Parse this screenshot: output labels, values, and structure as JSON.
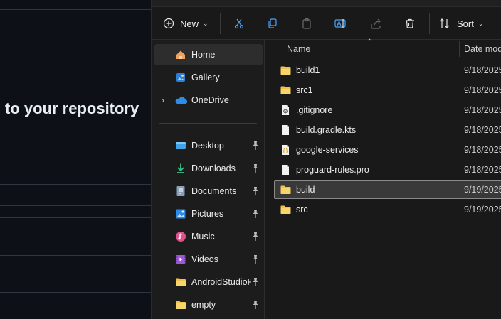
{
  "background_window": {
    "heading": "to your repository"
  },
  "toolbar": {
    "new_label": "New",
    "sort_label": "Sort"
  },
  "nav": {
    "items": [
      {
        "label": "Home",
        "icon": "home-icon"
      },
      {
        "label": "Gallery",
        "icon": "gallery-icon"
      },
      {
        "label": "OneDrive",
        "icon": "onedrive-icon"
      },
      {
        "label": "Desktop",
        "icon": "desktop-icon"
      },
      {
        "label": "Downloads",
        "icon": "downloads-icon"
      },
      {
        "label": "Documents",
        "icon": "documents-icon"
      },
      {
        "label": "Pictures",
        "icon": "pictures-icon"
      },
      {
        "label": "Music",
        "icon": "music-icon"
      },
      {
        "label": "Videos",
        "icon": "videos-icon"
      },
      {
        "label": "AndroidStudioP",
        "icon": "folder-icon"
      },
      {
        "label": "empty",
        "icon": "folder-icon"
      }
    ]
  },
  "files": {
    "columns": {
      "name": "Name",
      "date_modified": "Date mod"
    },
    "rows": [
      {
        "name": "build1",
        "date": "9/18/2025",
        "icon": "folder-icon"
      },
      {
        "name": "src1",
        "date": "9/18/2025",
        "icon": "folder-icon"
      },
      {
        "name": ".gitignore",
        "date": "9/18/2025",
        "icon": "settings-file-icon"
      },
      {
        "name": "build.gradle.kts",
        "date": "9/18/2025",
        "icon": "file-icon"
      },
      {
        "name": "google-services",
        "date": "9/18/2025",
        "icon": "json-file-icon"
      },
      {
        "name": "proguard-rules.pro",
        "date": "9/18/2025",
        "icon": "file-icon"
      },
      {
        "name": "build",
        "date": "9/19/2025",
        "icon": "folder-icon"
      },
      {
        "name": "src",
        "date": "9/19/2025",
        "icon": "folder-icon"
      }
    ]
  },
  "colors": {
    "folder": "#f0c24b",
    "accent_blue": "#4aa3ff",
    "selection_bg": "#393939"
  }
}
